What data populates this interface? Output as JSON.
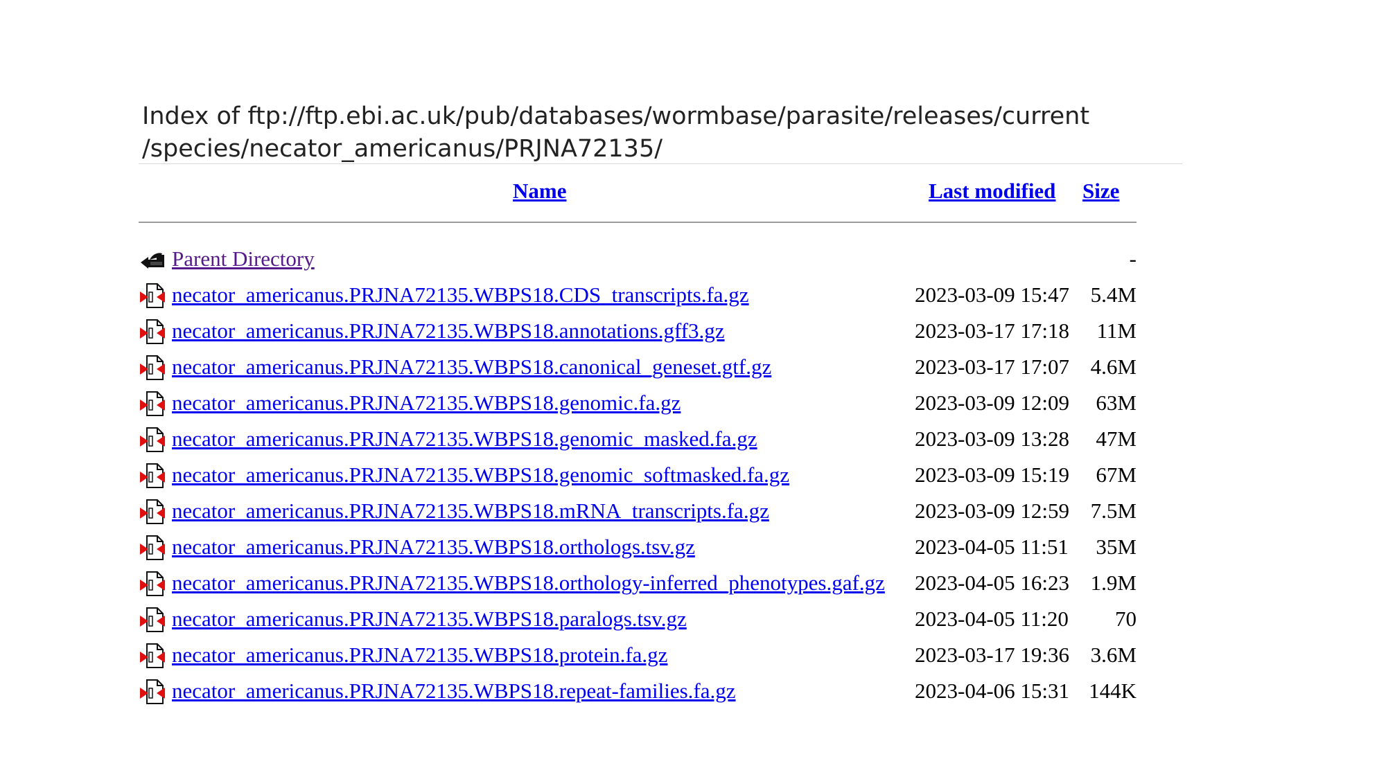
{
  "page": {
    "title_line1": "Index of ftp://ftp.ebi.ac.uk/pub/databases/wormbase/parasite/releases/current",
    "title_line2": "/species/necator_americanus/PRJNA72135/"
  },
  "table": {
    "headers": {
      "name": "Name",
      "last_modified": "Last modified",
      "size": "Size"
    },
    "parent": {
      "label": "Parent Directory",
      "size": "-",
      "icon": "back-folder-icon"
    },
    "files": [
      {
        "name": "necator_americanus.PRJNA72135.WBPS18.CDS_transcripts.fa.gz",
        "modified": "2023-03-09 15:47",
        "size": "5.4M"
      },
      {
        "name": "necator_americanus.PRJNA72135.WBPS18.annotations.gff3.gz",
        "modified": "2023-03-17 17:18",
        "size": "11M"
      },
      {
        "name": "necator_americanus.PRJNA72135.WBPS18.canonical_geneset.gtf.gz",
        "modified": "2023-03-17 17:07",
        "size": "4.6M"
      },
      {
        "name": "necator_americanus.PRJNA72135.WBPS18.genomic.fa.gz",
        "modified": "2023-03-09 12:09",
        "size": "63M"
      },
      {
        "name": "necator_americanus.PRJNA72135.WBPS18.genomic_masked.fa.gz",
        "modified": "2023-03-09 13:28",
        "size": "47M"
      },
      {
        "name": "necator_americanus.PRJNA72135.WBPS18.genomic_softmasked.fa.gz",
        "modified": "2023-03-09 15:19",
        "size": "67M"
      },
      {
        "name": "necator_americanus.PRJNA72135.WBPS18.mRNA_transcripts.fa.gz",
        "modified": "2023-03-09 12:59",
        "size": "7.5M"
      },
      {
        "name": "necator_americanus.PRJNA72135.WBPS18.orthologs.tsv.gz",
        "modified": "2023-04-05 11:51",
        "size": "35M"
      },
      {
        "name": "necator_americanus.PRJNA72135.WBPS18.orthology-inferred_phenotypes.gaf.gz",
        "modified": "2023-04-05 16:23",
        "size": "1.9M"
      },
      {
        "name": "necator_americanus.PRJNA72135.WBPS18.paralogs.tsv.gz",
        "modified": "2023-04-05 11:20",
        "size": "70"
      },
      {
        "name": "necator_americanus.PRJNA72135.WBPS18.protein.fa.gz",
        "modified": "2023-03-17 19:36",
        "size": "3.6M"
      },
      {
        "name": "necator_americanus.PRJNA72135.WBPS18.repeat-families.fa.gz",
        "modified": "2023-04-06 15:31",
        "size": "144K"
      }
    ],
    "file_icon": "compressed-file-icon"
  },
  "colors": {
    "link": "#0000ee",
    "visited_link": "#551a8b",
    "text": "#000000",
    "title_text": "#222222"
  }
}
